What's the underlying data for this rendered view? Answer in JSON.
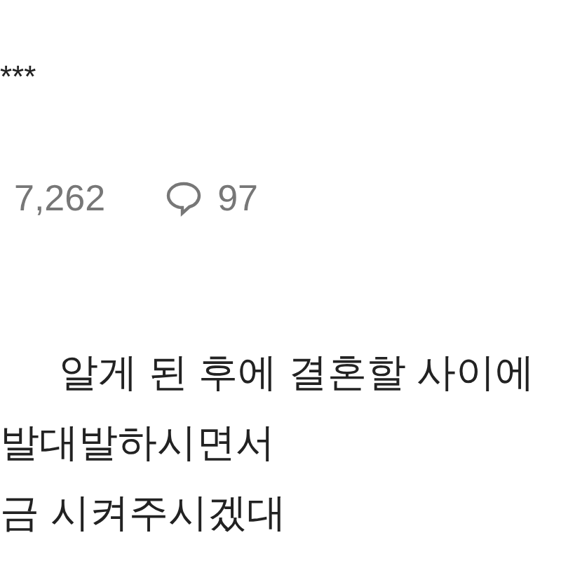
{
  "author_masked": "***",
  "stats": {
    "views": "7,262",
    "comments": "97"
  },
  "body_lines": [
    "알게 된 후에 결혼할 사이에",
    "발대발하시면서",
    "금 시켜주시겠대"
  ]
}
